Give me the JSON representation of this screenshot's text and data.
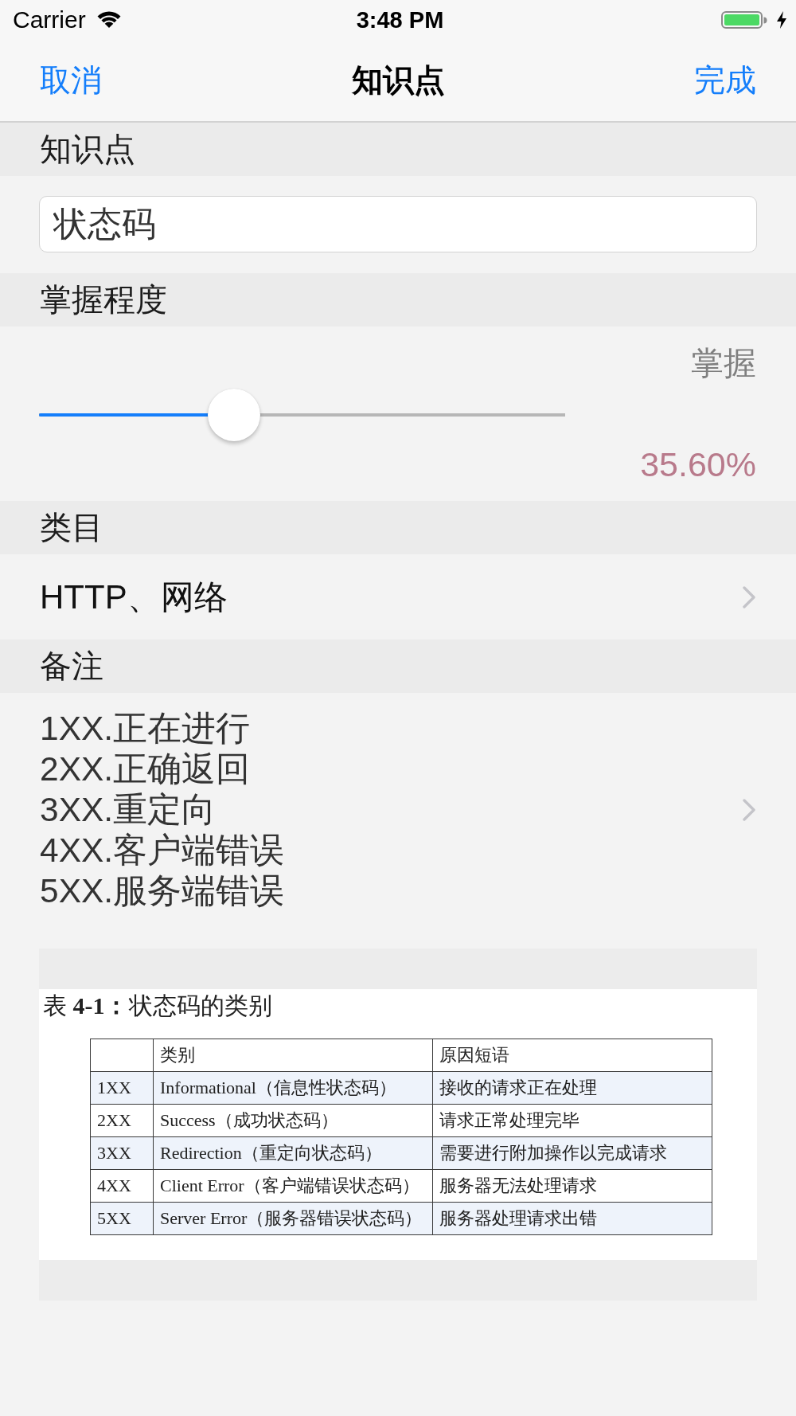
{
  "status_bar": {
    "carrier": "Carrier",
    "time": "3:48 PM"
  },
  "nav_bar": {
    "left_button": "取消",
    "title": "知识点",
    "right_button": "完成"
  },
  "sections": [
    {
      "kind": "text_field",
      "header": "知识点",
      "value": "状态码"
    },
    {
      "kind": "slider",
      "header": "掌握程度",
      "label": "掌握",
      "level": 0.356,
      "reading": "35.60%"
    },
    {
      "kind": "disclosure",
      "header": "类目",
      "value": "HTTP、网络"
    },
    {
      "kind": "notes",
      "header": "备注",
      "lines": [
        "1XX.正在进行",
        "2XX.正确返回",
        "3XX.重定向",
        "4XX.客户端错误",
        "5XX.服务端错误"
      ]
    }
  ],
  "attachment": {
    "caption": "表 **4-1：**状态码的类别",
    "columns": [
      "",
      "类别",
      "原因短语"
    ],
    "rows": [
      [
        "1XX",
        "Informational（信息性状态码）",
        "接收的请求正在处理"
      ],
      [
        "2XX",
        "Success（成功状态码）",
        "请求正常处理完毕"
      ],
      [
        "3XX",
        "Redirection（重定向状态码）",
        "需要进行附加操作以完成请求"
      ],
      [
        "4XX",
        "Client Error（客户端错误状态码）",
        "服务器无法处理请求"
      ],
      [
        "5XX",
        "Server Error（服务器错误状态码）",
        "服务器处理请求出错"
      ]
    ]
  }
}
